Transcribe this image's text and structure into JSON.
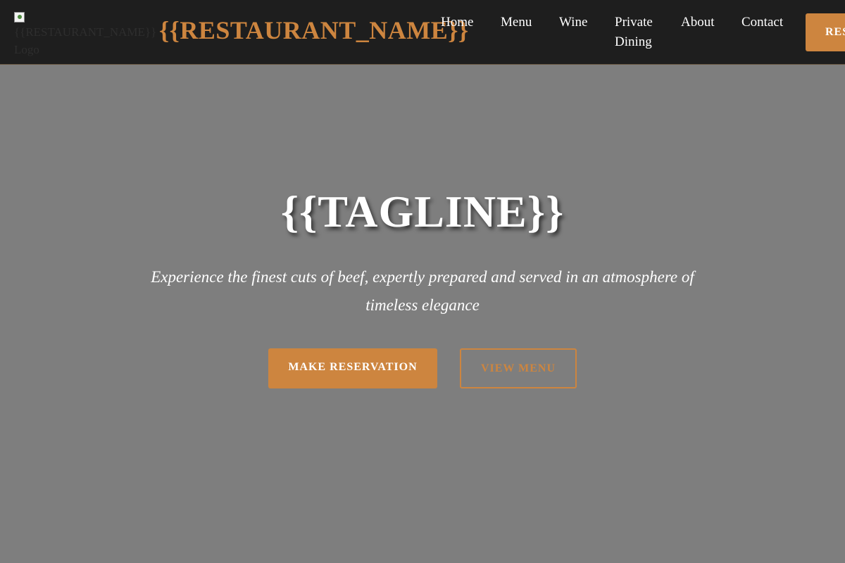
{
  "header": {
    "logo_alt": "{{RESTAURANT_NAME}} Logo",
    "brand": "{{RESTAURANT_NAME}}",
    "nav": [
      {
        "label": "Home"
      },
      {
        "label": "Menu"
      },
      {
        "label": "Wine"
      },
      {
        "label": "Private Dining"
      },
      {
        "label": "About"
      },
      {
        "label": "Contact"
      }
    ],
    "cta_label": "RESERVE"
  },
  "hero": {
    "tagline": "{{TAGLINE}}",
    "subtitle": "Experience the finest cuts of beef, expertly prepared and served in an atmosphere of timeless elegance",
    "primary_button": "MAKE RESERVATION",
    "secondary_button": "VIEW MENU"
  },
  "colors": {
    "accent": "#cd853f",
    "header_bg": "#1e1e1e",
    "hero_bg": "#7e7e7e"
  }
}
